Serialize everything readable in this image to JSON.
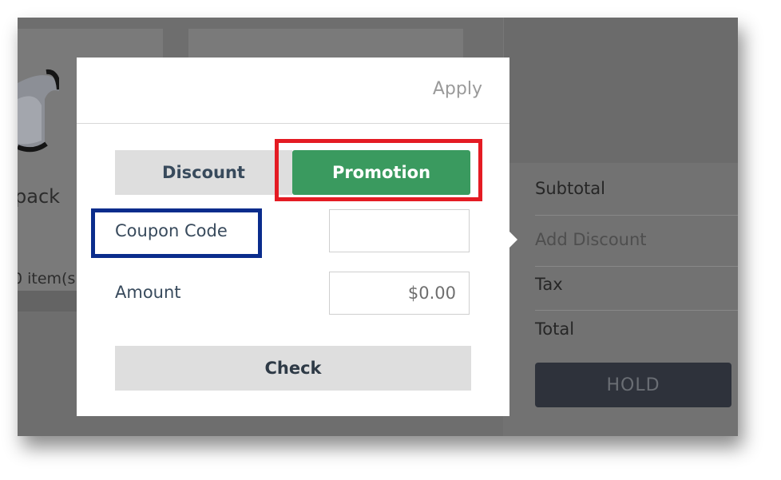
{
  "background": {
    "product": {
      "name": "pack",
      "count_text": "0 item(s"
    },
    "summary": {
      "rows": [
        "Subtotal",
        "Add Discount",
        "Tax",
        "Total"
      ],
      "hold_label": "HOLD"
    }
  },
  "modal": {
    "apply_label": "Apply",
    "tabs": {
      "discount": "Discount",
      "promotion": "Promotion"
    },
    "coupon_label": "Coupon Code",
    "coupon_value": "",
    "amount_label": "Amount",
    "amount_value": "$0.00",
    "check_label": "Check"
  },
  "colors": {
    "promotion_active": "#3a9a5f",
    "annotation_red": "#e41b23",
    "annotation_blue": "#0a2c8c"
  }
}
